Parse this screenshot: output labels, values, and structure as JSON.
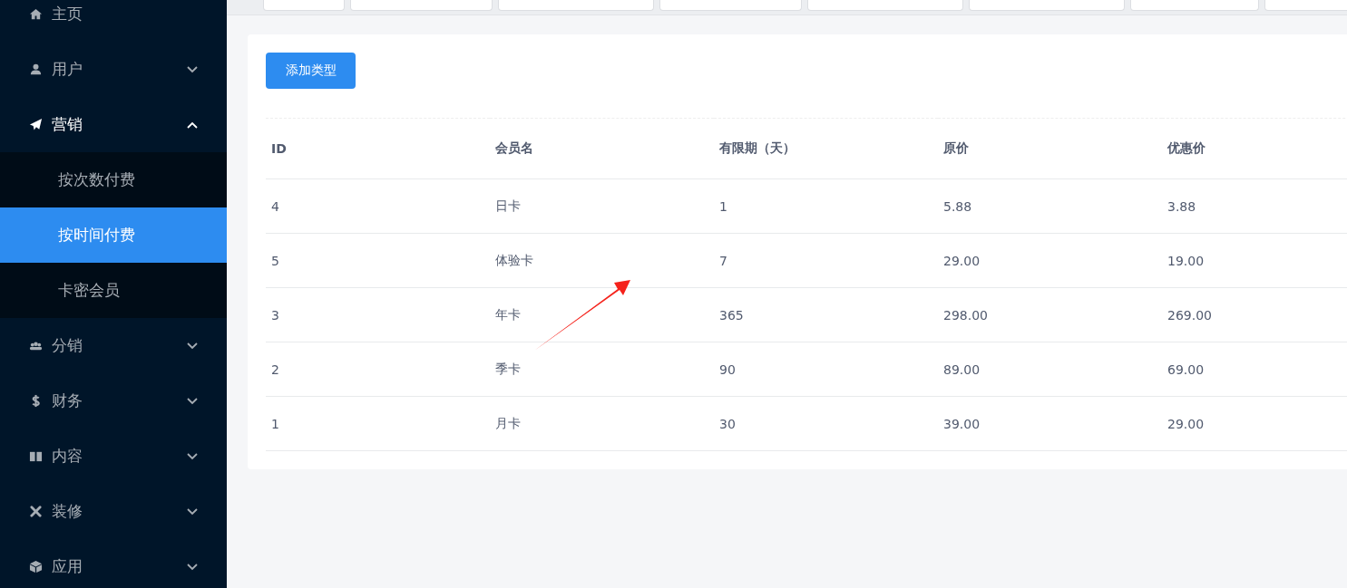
{
  "sidebar": {
    "items": [
      {
        "label": "主页",
        "kind": "link",
        "expanded": false
      },
      {
        "label": "用户",
        "kind": "group",
        "expanded": false
      },
      {
        "label": "营销",
        "kind": "group",
        "expanded": true,
        "children": [
          {
            "label": "按次数付费",
            "selected": false
          },
          {
            "label": "按时间付费",
            "selected": true
          },
          {
            "label": "卡密会员",
            "selected": false
          }
        ]
      },
      {
        "label": "分销",
        "kind": "group",
        "expanded": false
      },
      {
        "label": "财务",
        "kind": "group",
        "expanded": false
      },
      {
        "label": "内容",
        "kind": "group",
        "expanded": false
      },
      {
        "label": "装修",
        "kind": "group",
        "expanded": false
      },
      {
        "label": "应用",
        "kind": "group",
        "expanded": false
      }
    ]
  },
  "add_button": "添加类型",
  "table": {
    "columns": [
      "ID",
      "会员名",
      "有限期（天）",
      "原价",
      "优惠价"
    ],
    "rows": [
      [
        "4",
        "日卡",
        "1",
        "5.88",
        "3.88"
      ],
      [
        "5",
        "体验卡",
        "7",
        "29.00",
        "19.00"
      ],
      [
        "3",
        "年卡",
        "365",
        "298.00",
        "269.00"
      ],
      [
        "2",
        "季卡",
        "90",
        "89.00",
        "69.00"
      ],
      [
        "1",
        "月卡",
        "30",
        "39.00",
        "29.00"
      ]
    ]
  }
}
